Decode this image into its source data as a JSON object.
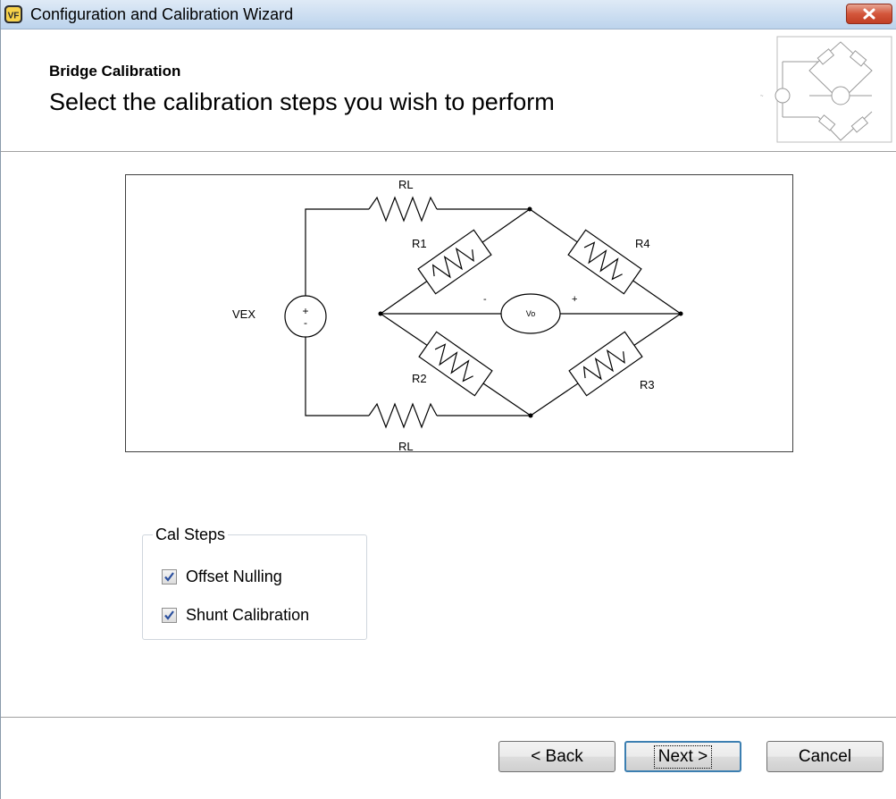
{
  "window": {
    "title": "Configuration and Calibration Wizard",
    "app_icon": "vf-app-icon",
    "close_icon": "close-icon"
  },
  "header": {
    "subtitle": "Bridge Calibration",
    "title": "Select the calibration steps you wish to perform",
    "thumbnail_icon": "bridge-circuit-thumbnail"
  },
  "schematic": {
    "vex_label": "VEX",
    "vo_label": "Vo",
    "r1": "R1",
    "r2": "R2",
    "r3": "R3",
    "r4": "R4",
    "rl_top": "RL",
    "rl_bottom": "RL",
    "plus": "+",
    "minus": "-"
  },
  "cal_steps": {
    "legend": "Cal Steps",
    "items": [
      {
        "label": "Offset Nulling",
        "checked": true
      },
      {
        "label": "Shunt Calibration",
        "checked": true
      }
    ]
  },
  "buttons": {
    "back": "< Back",
    "next": "Next >",
    "cancel": "Cancel"
  },
  "colors": {
    "titlebar": "#cfe0f2",
    "close": "#c13f25",
    "check": "#2a4f9e"
  }
}
